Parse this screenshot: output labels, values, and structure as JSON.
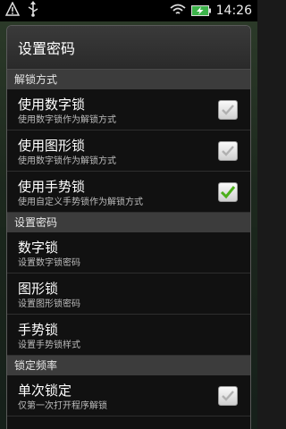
{
  "statusbar": {
    "time": "14:26",
    "icons": [
      "warning-icon",
      "usb-icon",
      "wifi-icon",
      "battery-charging-icon"
    ]
  },
  "dialog": {
    "title": "设置密码",
    "sections": [
      {
        "header": "解锁方式",
        "items": [
          {
            "title": "使用数字锁",
            "summary": "使用数字锁作为解锁方式",
            "checkbox": true,
            "checked": false
          },
          {
            "title": "使用图形锁",
            "summary": "使用数字锁作为解锁方式",
            "checkbox": true,
            "checked": false
          },
          {
            "title": "使用手势锁",
            "summary": "使用自定义手势锁作为解锁方式",
            "checkbox": true,
            "checked": true
          }
        ]
      },
      {
        "header": "设置密码",
        "items": [
          {
            "title": "数字锁",
            "summary": "设置数字锁密码"
          },
          {
            "title": "图形锁",
            "summary": "设置图形锁密码"
          },
          {
            "title": "手势锁",
            "summary": "设置手势锁样式"
          }
        ]
      },
      {
        "header": "锁定频率",
        "items": [
          {
            "title": "单次锁定",
            "summary": "仅第一次打开程序解锁",
            "checkbox": true,
            "checked": false
          }
        ]
      }
    ]
  },
  "colors": {
    "check_green": "#4caf1a",
    "check_gray": "#b0b0b0",
    "section_bg": "#3c3c3c"
  }
}
